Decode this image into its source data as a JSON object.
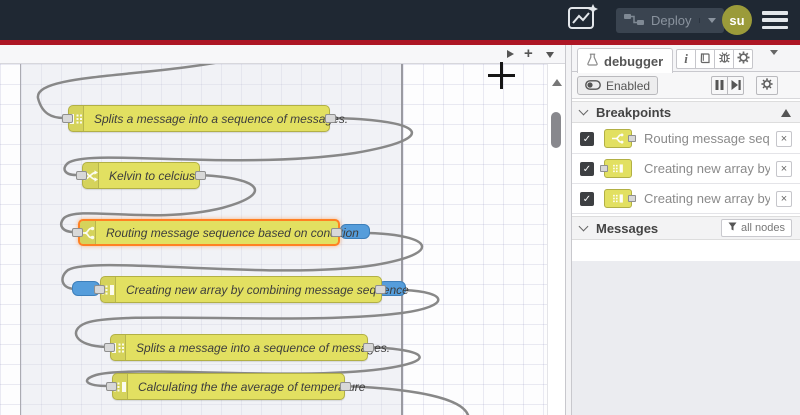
{
  "header": {
    "deploy_label": "Deploy",
    "avatar_label": "su"
  },
  "glyphs": {
    "plus": "+",
    "info": "i",
    "close": "×",
    "check": "✓"
  },
  "colors": {
    "header_bg": "#1f2833",
    "accent_red": "#ad1625",
    "node_yellow": "#e2e061",
    "node_border": "#b2b045",
    "selected_orange": "#ff8123",
    "breakpoint_blue": "#559ddb",
    "wire_grey": "#888888",
    "avatar_olive": "#9b9b3a"
  },
  "canvas": {
    "nodes": [
      {
        "label": "Splits a message into a sequence of messages.",
        "type": "split"
      },
      {
        "label": "Kelvin to celcius",
        "type": "change"
      },
      {
        "label": "Routing message sequence based on condition",
        "type": "switch",
        "selected": true
      },
      {
        "label": "Creating new array by combining message sequence",
        "type": "join"
      },
      {
        "label": "Splits a message into a sequence of messages.",
        "type": "split"
      },
      {
        "label": "Calculating the the average of temperature",
        "type": "join"
      }
    ]
  },
  "sidebar": {
    "tab_label": "debugger",
    "toolbar": {
      "enabled_label": "Enabled"
    },
    "breakpoints": {
      "title": "Breakpoints",
      "items": [
        {
          "label": "Routing message sequence ba",
          "checked": true
        },
        {
          "label": "Creating new array by combini",
          "checked": true
        },
        {
          "label": "Creating new array by combini",
          "checked": true
        }
      ]
    },
    "messages": {
      "title": "Messages",
      "filter_label": "all nodes"
    }
  }
}
